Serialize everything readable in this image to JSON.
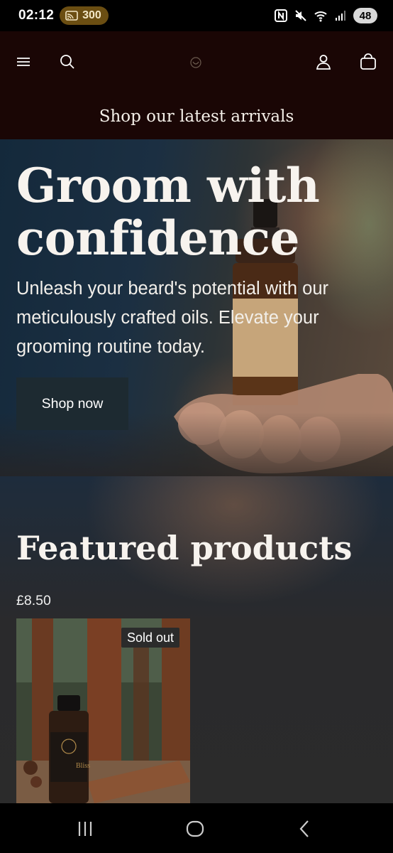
{
  "status_bar": {
    "time": "02:12",
    "cast_count": "300",
    "battery": "48"
  },
  "header": {
    "icons": [
      "menu-icon",
      "search-icon",
      "logo-icon",
      "account-icon",
      "cart-icon"
    ]
  },
  "announcement": "Shop our latest arrivals",
  "hero": {
    "title": "Groom with confidence",
    "subtitle": "Unleash your beard's potential with our meticulously crafted oils. Elevate your grooming routine today.",
    "button_label": "Shop now"
  },
  "featured": {
    "title": "Featured products",
    "products": [
      {
        "price": "£8.50",
        "badge": "Sold out",
        "bottle_label": "Bliss"
      }
    ]
  },
  "navbar": {
    "icons": [
      "recents-icon",
      "home-icon",
      "back-icon"
    ]
  },
  "colors": {
    "header_bg": "#1a0605",
    "button_bg": "#1d2a31",
    "cast_pill": "#6b4e12"
  }
}
